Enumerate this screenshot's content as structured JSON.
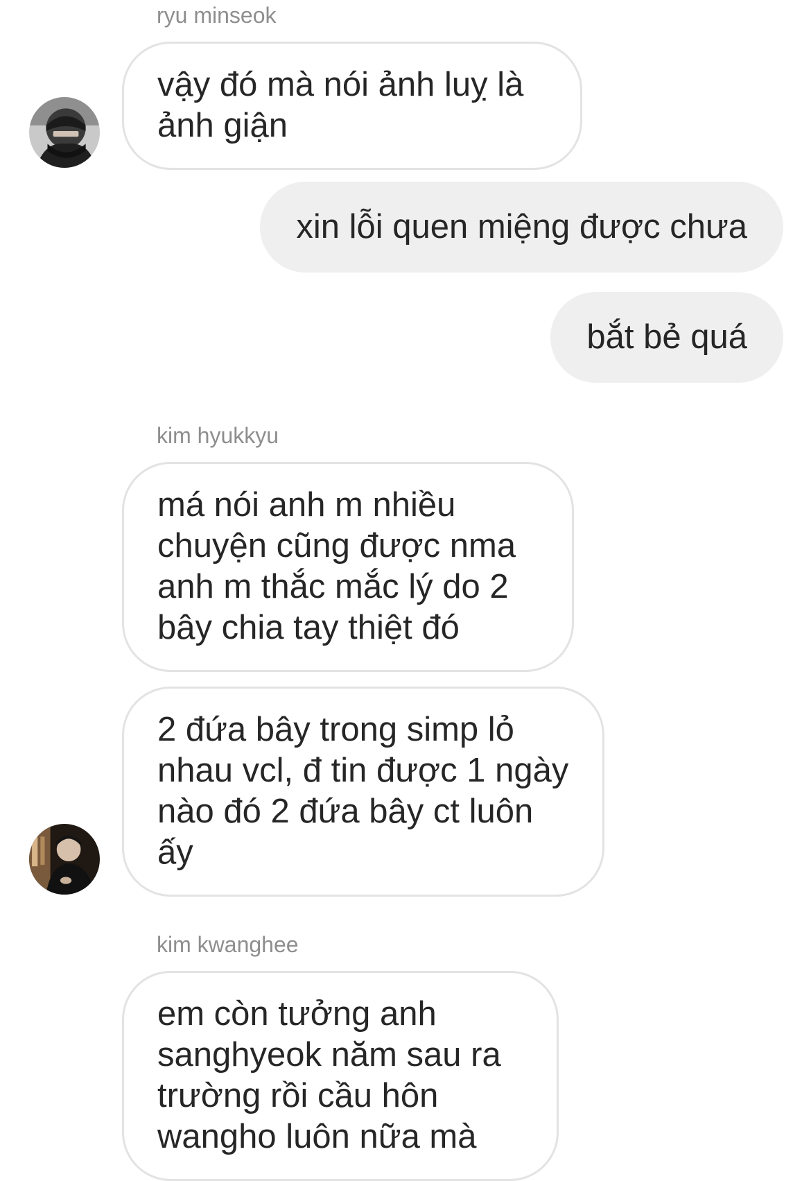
{
  "thread": {
    "groups": [
      {
        "sender": "ryu minseok",
        "messages": [
          "vậy đó mà nói ảnh luỵ là ảnh giận"
        ]
      },
      {
        "outgoing": [
          "xin lỗi quen miệng được chưa",
          "bắt bẻ quá"
        ]
      },
      {
        "sender": "kim hyukkyu",
        "messages": [
          "má nói anh m nhiều chuyện cũng được nma anh m thắc mắc lý do 2 bây chia tay thiệt đó",
          "2 đứa bây trong simp lỏ nhau vcl, đ tin được 1 ngày nào đó 2 đứa bây ct luôn ấy"
        ]
      },
      {
        "sender": "kim kwanghee",
        "messages": [
          "em còn tưởng anh sanghyeok năm sau ra trường rồi cầu hôn wangho luôn nữa mà"
        ]
      }
    ]
  },
  "colors": {
    "incoming_bubble": "#ffffff",
    "incoming_border": "#e3e3e3",
    "outgoing_bubble": "#efefef",
    "sender_name": "#8e8e8e",
    "message_text": "#262626"
  },
  "icons": {
    "avatar_1": "profile-photo",
    "avatar_2": "profile-photo"
  }
}
